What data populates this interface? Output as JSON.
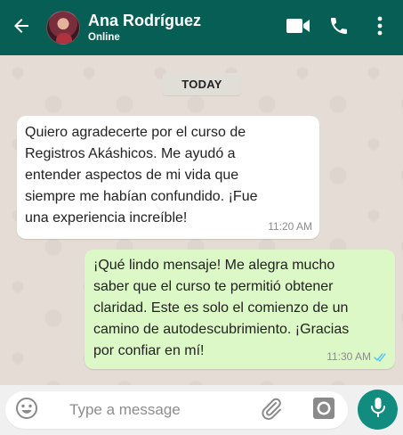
{
  "header": {
    "contact_name": "Ana Rodríguez",
    "status": "Online",
    "icons": {
      "back": "arrow-left-icon",
      "video": "video-call-icon",
      "call": "phone-icon",
      "menu": "more-vertical-icon"
    }
  },
  "chat": {
    "date_label": "TODAY",
    "messages": [
      {
        "direction": "incoming",
        "text": "Quiero agradecerte por el curso de\nRegistros Akáshicos. Me ayudó a\nentender aspectos de mi vida que\nsiempre me habían confundido. ¡Fue\nuna experiencia increíble!",
        "time": "11:20 AM"
      },
      {
        "direction": "outgoing",
        "text": "¡Qué lindo mensaje! Me alegra mucho\nsaber que el curso te permitió obtener\nclaridad. Este es solo el comienzo de un\ncamino de autodescubrimiento. ¡Gracias\npor confiar en mí!",
        "time": "11:30 AM",
        "status_icon": "double-check-read-icon"
      }
    ]
  },
  "composer": {
    "placeholder": "Type a message",
    "value": "",
    "icons": {
      "emoji": "emoji-icon",
      "attach": "paperclip-icon",
      "camera": "camera-icon",
      "mic": "microphone-icon"
    }
  },
  "colors": {
    "header_bg": "#075e54",
    "outgoing_bubble": "#dcf8c6",
    "incoming_bubble": "#ffffff",
    "chat_bg": "#e5ddd5",
    "read_tick": "#4fc3f7",
    "mic_button": "#128c7e"
  }
}
